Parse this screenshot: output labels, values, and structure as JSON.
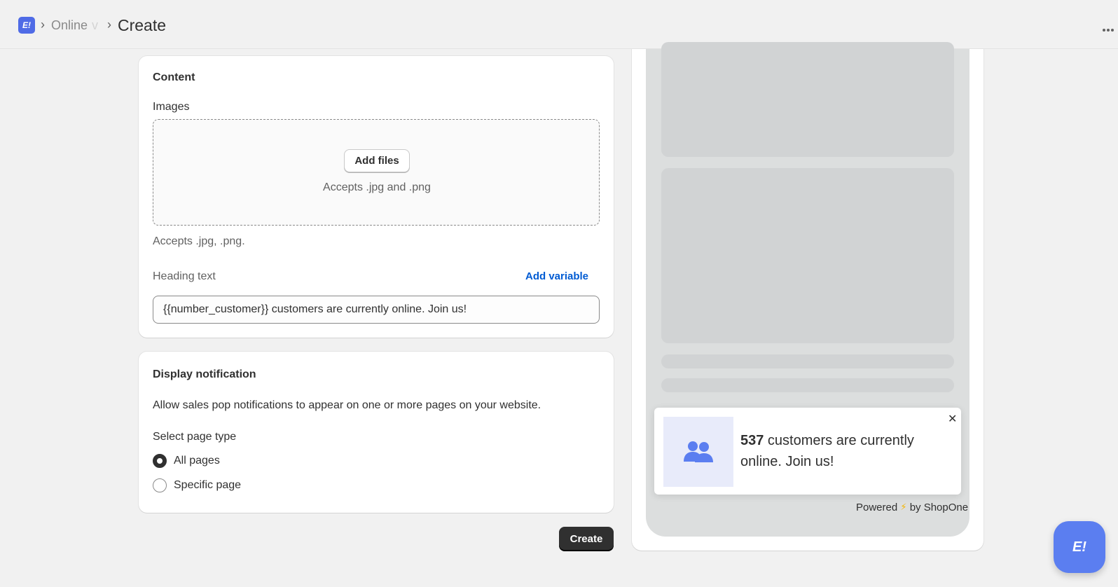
{
  "header": {
    "logo_text": "E!",
    "breadcrumb_online": "Online",
    "breadcrumb_truncated": "v",
    "title": "Create",
    "more_icon": "more-horizontal-icon"
  },
  "content_card": {
    "title": "Content",
    "images_label": "Images",
    "add_files_label": "Add files",
    "dropzone_hint": "Accepts .jpg and .png",
    "accepts_note": "Accepts .jpg, .png.",
    "heading_label": "Heading text",
    "add_variable_label": "Add variable",
    "heading_value": "{{number_customer}} customers are currently online. Join us!"
  },
  "display_card": {
    "title": "Display notification",
    "description": "Allow sales pop notifications to appear on one or more pages on your website.",
    "select_label": "Select page type",
    "options": [
      {
        "label": "All pages",
        "checked": true
      },
      {
        "label": "Specific page",
        "checked": false
      }
    ]
  },
  "create_button_label": "Create",
  "preview": {
    "notification": {
      "number": "537",
      "text": " customers are currently online. Join us!",
      "icon": "users-icon",
      "close_label": "✕"
    },
    "powered_prefix": "Powered",
    "powered_suffix": "by ShopOne",
    "bolt": "⚡"
  },
  "fab_logo_text": "E!",
  "colors": {
    "accent": "#4f6be6",
    "link": "#005bd3",
    "primary_button": "#303030",
    "fab": "#5b7ef0"
  }
}
